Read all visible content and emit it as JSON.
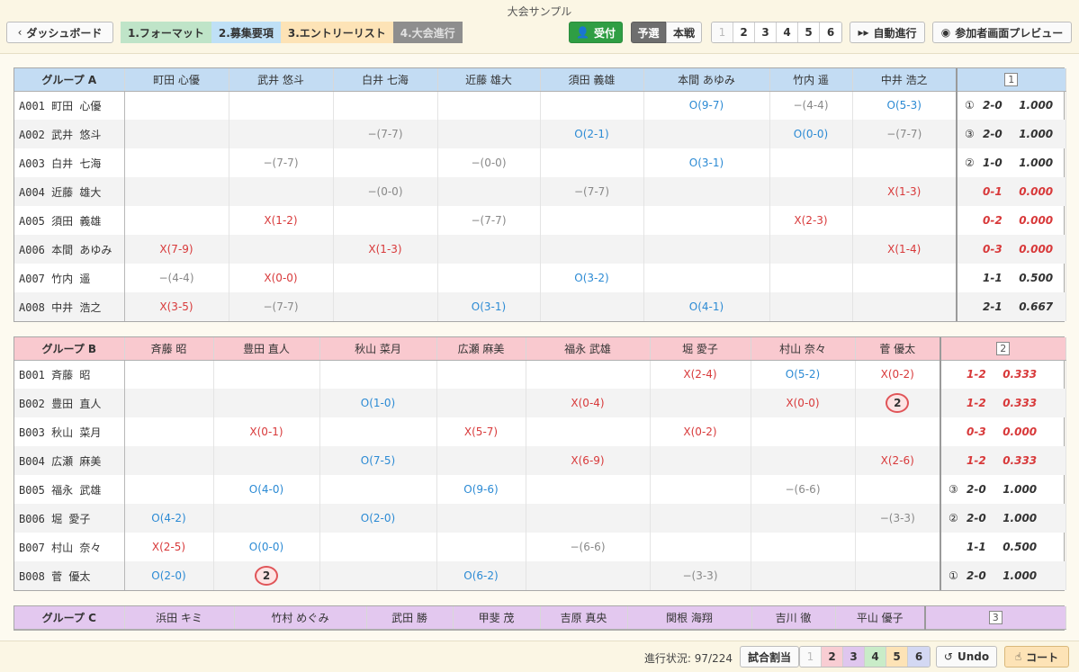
{
  "header": {
    "title": "大会サンプル",
    "dashboard_label": "ダッシュボード",
    "steps": [
      {
        "label": "1.フォーマット",
        "bg": "#bfe4c8",
        "color": "#333"
      },
      {
        "label": "2.募集要項",
        "bg": "#bfe0f6",
        "color": "#333"
      },
      {
        "label": "3.エントリーリスト",
        "bg": "#fde3b6",
        "color": "#333"
      },
      {
        "label": "4.大会進行",
        "bg": "#8e8e8e",
        "color": "#e0e0e0"
      }
    ],
    "reception_label": "受付",
    "yosen_label": "予選",
    "honsen_label": "本戦",
    "pages": [
      "1",
      "2",
      "3",
      "4",
      "5",
      "6"
    ],
    "auto_label": "自動進行",
    "preview_label": "参加者画面プレビュー"
  },
  "colors": {
    "accent_green": "#2f9e44",
    "win": "#2b8ad4",
    "lose": "#d8393a",
    "draw": "#888888"
  },
  "groups": [
    {
      "name": "グループ A",
      "number": "1",
      "header_bg": "#c3dcf3",
      "columns": [
        "町田 心優",
        "武井 悠斗",
        "白井 七海",
        "近藤 雄大",
        "須田 義雄",
        "本間 あゆみ",
        "竹内 遥",
        "中井 浩之"
      ],
      "rows": [
        {
          "id": "A001",
          "name": "町田 心優",
          "cells": [
            "",
            "",
            "",
            "",
            "",
            "O(9-7)",
            "−(4-4)",
            "O(5-3)"
          ],
          "rank": "①",
          "record": "2-0",
          "rate": "1.000",
          "neg": false
        },
        {
          "id": "A002",
          "name": "武井 悠斗",
          "cells": [
            "",
            "",
            "−(7-7)",
            "",
            "O(2-1)",
            "",
            "O(0-0)",
            "−(7-7)"
          ],
          "rank": "③",
          "record": "2-0",
          "rate": "1.000",
          "neg": false
        },
        {
          "id": "A003",
          "name": "白井 七海",
          "cells": [
            "",
            "−(7-7)",
            "",
            "−(0-0)",
            "",
            "O(3-1)",
            "",
            ""
          ],
          "rank": "②",
          "record": "1-0",
          "rate": "1.000",
          "neg": false
        },
        {
          "id": "A004",
          "name": "近藤 雄大",
          "cells": [
            "",
            "",
            "−(0-0)",
            "",
            "−(7-7)",
            "",
            "",
            "X(1-3)"
          ],
          "rank": "",
          "record": "0-1",
          "rate": "0.000",
          "neg": true
        },
        {
          "id": "A005",
          "name": "須田 義雄",
          "cells": [
            "",
            "X(1-2)",
            "",
            "−(7-7)",
            "",
            "",
            "X(2-3)",
            ""
          ],
          "rank": "",
          "record": "0-2",
          "rate": "0.000",
          "neg": true
        },
        {
          "id": "A006",
          "name": "本間 あゆみ",
          "cells": [
            "X(7-9)",
            "",
            "X(1-3)",
            "",
            "",
            "",
            "",
            "X(1-4)"
          ],
          "rank": "",
          "record": "0-3",
          "rate": "0.000",
          "neg": true
        },
        {
          "id": "A007",
          "name": "竹内 遥",
          "cells": [
            "−(4-4)",
            "X(0-0)",
            "",
            "",
            "O(3-2)",
            "",
            "",
            ""
          ],
          "rank": "",
          "record": "1-1",
          "rate": "0.500",
          "neg": false
        },
        {
          "id": "A008",
          "name": "中井 浩之",
          "cells": [
            "X(3-5)",
            "−(7-7)",
            "",
            "O(3-1)",
            "",
            "O(4-1)",
            "",
            ""
          ],
          "rank": "",
          "record": "2-1",
          "rate": "0.667",
          "neg": false
        }
      ]
    },
    {
      "name": "グループ B",
      "number": "2",
      "header_bg": "#f9c9cf",
      "columns": [
        "斉藤 昭",
        "豊田 直人",
        "秋山 菜月",
        "広瀬 麻美",
        "福永 武雄",
        "堀 愛子",
        "村山 奈々",
        "菅 優太"
      ],
      "rows": [
        {
          "id": "B001",
          "name": "斉藤 昭",
          "cells": [
            "",
            "",
            "",
            "",
            "",
            "X(2-4)",
            "O(5-2)",
            "X(0-2)"
          ],
          "rank": "",
          "record": "1-2",
          "rate": "0.333",
          "neg": true
        },
        {
          "id": "B002",
          "name": "豊田 直人",
          "cells": [
            "",
            "",
            "O(1-0)",
            "",
            "X(0-4)",
            "",
            "X(0-0)",
            "#2"
          ],
          "rank": "",
          "record": "1-2",
          "rate": "0.333",
          "neg": true
        },
        {
          "id": "B003",
          "name": "秋山 菜月",
          "cells": [
            "",
            "X(0-1)",
            "",
            "X(5-7)",
            "",
            "X(0-2)",
            "",
            ""
          ],
          "rank": "",
          "record": "0-3",
          "rate": "0.000",
          "neg": true
        },
        {
          "id": "B004",
          "name": "広瀬 麻美",
          "cells": [
            "",
            "",
            "O(7-5)",
            "",
            "X(6-9)",
            "",
            "",
            "X(2-6)"
          ],
          "rank": "",
          "record": "1-2",
          "rate": "0.333",
          "neg": true
        },
        {
          "id": "B005",
          "name": "福永 武雄",
          "cells": [
            "",
            "O(4-0)",
            "",
            "O(9-6)",
            "",
            "",
            "−(6-6)",
            ""
          ],
          "rank": "③",
          "record": "2-0",
          "rate": "1.000",
          "neg": false
        },
        {
          "id": "B006",
          "name": "堀 愛子",
          "cells": [
            "O(4-2)",
            "",
            "O(2-0)",
            "",
            "",
            "",
            "",
            "−(3-3)"
          ],
          "rank": "②",
          "record": "2-0",
          "rate": "1.000",
          "neg": false
        },
        {
          "id": "B007",
          "name": "村山 奈々",
          "cells": [
            "X(2-5)",
            "O(0-0)",
            "",
            "",
            "−(6-6)",
            "",
            "",
            ""
          ],
          "rank": "",
          "record": "1-1",
          "rate": "0.500",
          "neg": false
        },
        {
          "id": "B008",
          "name": "菅 優太",
          "cells": [
            "O(2-0)",
            "#2",
            "",
            "O(6-2)",
            "",
            "−(3-3)",
            "",
            ""
          ],
          "rank": "①",
          "record": "2-0",
          "rate": "1.000",
          "neg": false
        }
      ]
    },
    {
      "name": "グループ C",
      "number": "3",
      "header_bg": "#e3c8ef",
      "columns": [
        "浜田 キミ",
        "竹村 めぐみ",
        "武田 勝",
        "甲斐 茂",
        "吉原 真央",
        "関根 海翔",
        "吉川 徹",
        "平山 優子"
      ],
      "rows": []
    }
  ],
  "footer": {
    "progress": "進行状況: 97/224",
    "assign_label": "試合割当",
    "pages": [
      "1",
      "2",
      "3",
      "4",
      "5",
      "6"
    ],
    "undo_label": "Undo",
    "court_label": "コート"
  }
}
